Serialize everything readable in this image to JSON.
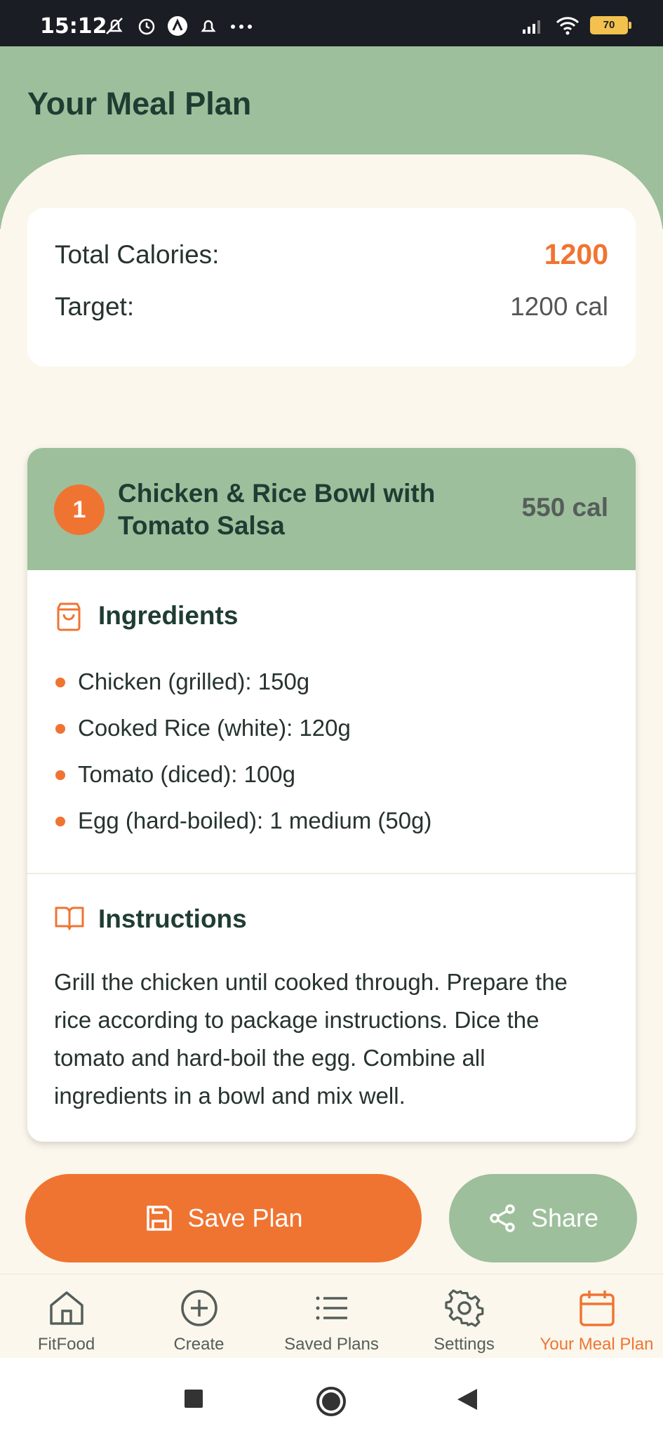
{
  "status_bar": {
    "time": "15:12",
    "battery": "70"
  },
  "header": {
    "title": "Your Meal Plan"
  },
  "summary": {
    "total_label": "Total Calories:",
    "total_value": "1200",
    "target_label": "Target:",
    "target_value": "1200 cal"
  },
  "meal": {
    "number": "1",
    "title": "Chicken & Rice Bowl with Tomato Salsa",
    "calories": "550 cal",
    "ingredients_title": "Ingredients",
    "ingredients": [
      "Chicken (grilled): 150g",
      "Cooked Rice (white): 120g",
      "Tomato (diced): 100g",
      "Egg (hard-boiled): 1 medium (50g)"
    ],
    "instructions_title": "Instructions",
    "instructions": "Grill the chicken until cooked through. Prepare the rice according to package instructions. Dice the tomato and hard-boil the egg. Combine all ingredients in a bowl and mix well."
  },
  "actions": {
    "save_label": "Save Plan",
    "share_label": "Share"
  },
  "bottom_nav": {
    "items": [
      {
        "label": "FitFood",
        "icon": "home-icon"
      },
      {
        "label": "Create",
        "icon": "plus-circle-icon"
      },
      {
        "label": "Saved Plans",
        "icon": "list-icon"
      },
      {
        "label": "Settings",
        "icon": "gear-icon"
      },
      {
        "label": "Your Meal Plan",
        "icon": "calendar-icon",
        "active": true
      }
    ]
  },
  "colors": {
    "accent": "#f07431",
    "sage": "#9dbf9b",
    "background": "#fbf7ec",
    "text_dark": "#1f3d33"
  }
}
